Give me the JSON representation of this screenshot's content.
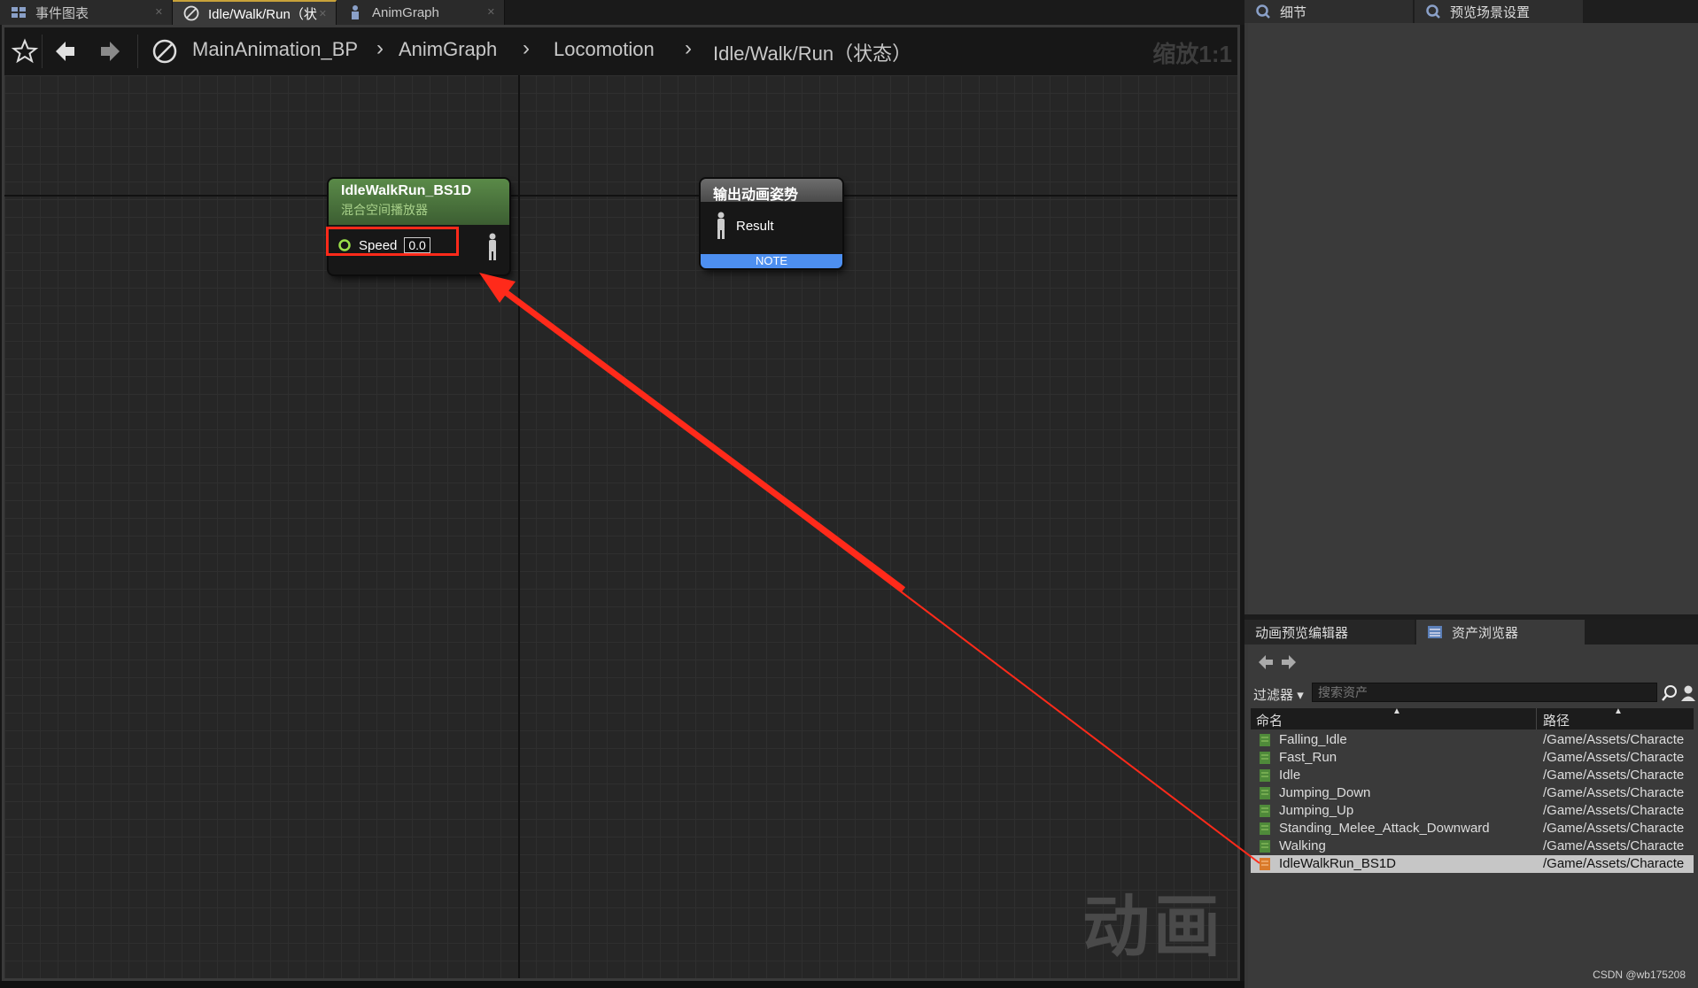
{
  "tabs": [
    {
      "label": "事件图表",
      "icon": "event-graph-icon"
    },
    {
      "label": "Idle/Walk/Run（状",
      "icon": "state-icon"
    },
    {
      "label": "AnimGraph",
      "icon": "anim-graph-icon"
    }
  ],
  "breadcrumb": [
    "MainAnimation_BP",
    "AnimGraph",
    "Locomotion",
    "Idle/Walk/Run（状态）"
  ],
  "zoom_label": "缩放1:1",
  "watermark": "动画",
  "blend_node": {
    "title": "IdleWalkRun_BS1D",
    "subtitle": "混合空间播放器",
    "pin_label": "Speed",
    "pin_value": "0.0"
  },
  "output_node": {
    "title": "输出动画姿势",
    "pin_label": "Result",
    "note": "NOTE"
  },
  "right_tabs": [
    "细节",
    "预览场景设置"
  ],
  "bottom_tabs": [
    "动画预览编辑器",
    "资产浏览器"
  ],
  "asset_browser": {
    "filter_label": "过滤器",
    "search_placeholder": "搜索资产",
    "columns": {
      "name": "命名",
      "path": "路径"
    },
    "rows": [
      {
        "name": "Falling_Idle",
        "path": "/Game/Assets/Characte"
      },
      {
        "name": "Fast_Run",
        "path": "/Game/Assets/Characte"
      },
      {
        "name": "Idle",
        "path": "/Game/Assets/Characte"
      },
      {
        "name": "Jumping_Down",
        "path": "/Game/Assets/Characte"
      },
      {
        "name": "Jumping_Up",
        "path": "/Game/Assets/Characte"
      },
      {
        "name": "Standing_Melee_Attack_Downward",
        "path": "/Game/Assets/Characte"
      },
      {
        "name": "Walking",
        "path": "/Game/Assets/Characte"
      },
      {
        "name": "IdleWalkRun_BS1D",
        "path": "/Game/Assets/Characte"
      }
    ]
  },
  "credit": "CSDN @wb175208",
  "colors": {
    "annotation": "#ff2a1a",
    "blend_node_header": "#4a7a3a",
    "note_bar": "#4d8ff0"
  }
}
